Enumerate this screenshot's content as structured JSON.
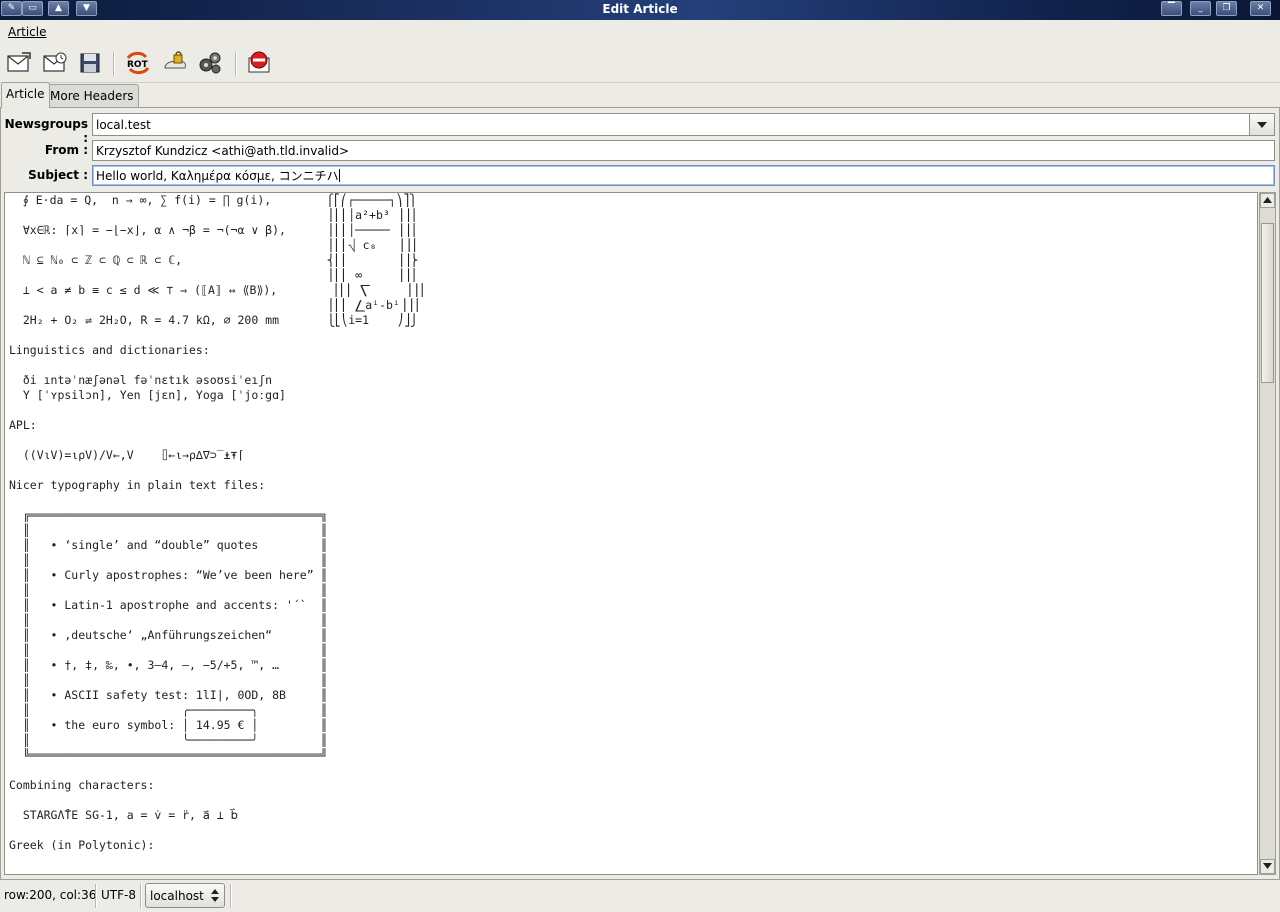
{
  "window": {
    "title": "Edit Article"
  },
  "menubar": {
    "items": [
      {
        "label": "Article"
      }
    ]
  },
  "toolbar": {
    "buttons": [
      {
        "icon": "send-mail-icon"
      },
      {
        "icon": "send-later-icon"
      },
      {
        "icon": "save-icon"
      },
      {
        "icon": "rot13-icon",
        "label": "ROT"
      },
      {
        "icon": "sign-icon"
      },
      {
        "icon": "settings-icon"
      },
      {
        "icon": "cancel-icon"
      }
    ]
  },
  "tabs": [
    {
      "label": "Article"
    },
    {
      "label": "More Headers"
    }
  ],
  "headers": {
    "newsgroups": {
      "label": "Newsgroups :",
      "value": "local.test"
    },
    "from": {
      "label": "From :",
      "value": "Krzysztof Kundzicz <athi@ath.tld.invalid>"
    },
    "subject": {
      "label": "Subject :",
      "value": "Hello world, Καλημέρα κόσμε, コンニチハ"
    }
  },
  "editor": {
    "body": "  ∮ E⋅da = Q,  n → ∞, ∑ f(i) = ∏ g(i),        ⎧⎡⎛┌─────┐⎞⎤⎫\n                                              ⎪⎢⎜│a²+b³ ⎟⎥⎪\n  ∀x∈ℝ: ⌈x⌉ = −⌊−x⌋, α ∧ ¬β = ¬(¬α ∨ β),      ⎪⎢⎜│───── ⎟⎥⎪\n                                              ⎪⎢⎜⎷ c₈   ⎟⎥⎪\n  ℕ ⊆ ℕ₀ ⊂ ℤ ⊂ ℚ ⊂ ℝ ⊂ ℂ,                     ⎨⎢⎜       ⎟⎥⎬\n                                              ⎪⎢⎜ ∞     ⎟⎥⎪\n  ⊥ < a ≠ b ≡ c ≤ d ≪ ⊤ ⇒ (⟦A⟧ ⇔ ⟪B⟫),        ⎪⎢⎜ ⎲     ⎟⎥⎪\n                                              ⎪⎢⎜ ⎳aⁱ-bⁱ⎟⎥⎪\n  2H₂ + O₂ ⇌ 2H₂O, R = 4.7 kΩ, ⌀ 200 mm       ⎩⎣⎝i=1    ⎠⎦⎭\n\nLinguistics and dictionaries:\n\n  ði ıntəˈnæʃənəl fəˈnɛtık əsoʊsiˈeıʃn\n  Y [ˈʏpsilɔn], Yen [jɛn], Yoga [ˈjoːgɑ]\n\nAPL:\n\n  ((V⍳V)=⍳⍴V)/V←,V    ⌷←⍳→⍴∆∇⊃‾⍎⍕⌈\n\nNicer typography in plain text files:\n\n  ╔══════════════════════════════════════════╗\n  ║                                          ║\n  ║   • ‘single’ and “double” quotes         ║\n  ║                                          ║\n  ║   • Curly apostrophes: “We’ve been here” ║\n  ║                                          ║\n  ║   • Latin-1 apostrophe and accents: '´`  ║\n  ║                                          ║\n  ║   • ‚deutsche‘ „Anführungszeichen“       ║\n  ║                                          ║\n  ║   • †, ‡, ‰, •, 3–4, —, −5/+5, ™, …      ║\n  ║                                          ║\n  ║   • ASCII safety test: 1lI|, 0OD, 8B     ║\n  ║                      ╭─────────╮         ║\n  ║   • the euro symbol: │ 14.95 € │         ║\n  ║                      ╰─────────╯         ║\n  ╚══════════════════════════════════════════╝\n\nCombining characters:\n\n  STARGΛ̊TE SG-1, a = v̇ = r̈, a⃑ ⊥ b⃑\n\nGreek (in Polytonic):"
  },
  "statusbar": {
    "position": "row:200, col:36",
    "encoding": "UTF-8",
    "server": "localhost"
  }
}
